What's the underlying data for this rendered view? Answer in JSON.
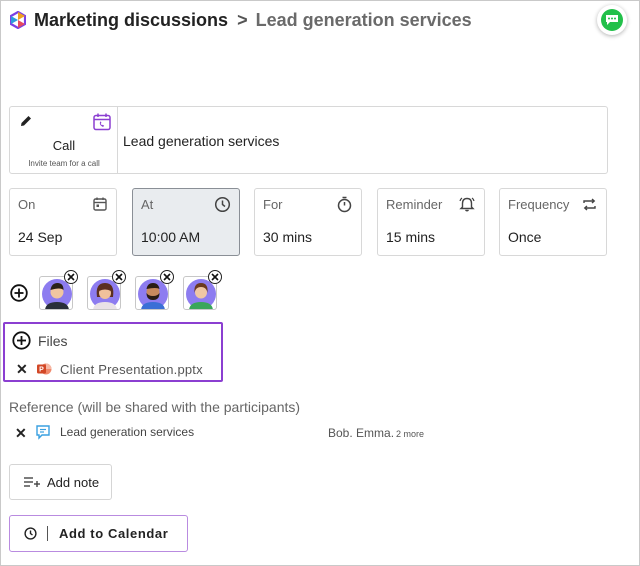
{
  "header": {
    "title": "Marketing discussions",
    "separator": ">",
    "subtitle": "Lead generation services"
  },
  "call": {
    "type_label": "Call",
    "type_hint": "Invite team for a call",
    "subject": "Lead generation services"
  },
  "fields": [
    {
      "label": "On",
      "value": "24 Sep",
      "icon": "calendar-icon"
    },
    {
      "label": "At",
      "value": "10:00 AM",
      "icon": "clock-icon"
    },
    {
      "label": "For",
      "value": "30 mins",
      "icon": "timer-icon"
    },
    {
      "label": "Reminder",
      "value": "15 mins",
      "icon": "bell-icon"
    },
    {
      "label": "Frequency",
      "value": "Once",
      "icon": "repeat-icon"
    }
  ],
  "participants": [
    {
      "avatar": "man-avatar"
    },
    {
      "avatar": "woman-avatar"
    },
    {
      "avatar": "bearded-man-avatar"
    },
    {
      "avatar": "woman-green-avatar"
    }
  ],
  "files": {
    "label": "Files",
    "remove_glyph": "✕",
    "items": [
      {
        "name": "Client Presentation.pptx",
        "icon": "powerpoint-icon"
      }
    ]
  },
  "reference": {
    "heading": "Reference (will be shared with the participants)",
    "remove_glyph": "✕",
    "name": "Lead generation services",
    "people": "Bob. Emma.",
    "more": "2 more"
  },
  "buttons": {
    "add_note": "Add note",
    "add_to_calendar": "Add to Calendar"
  },
  "colors": {
    "accent_purple": "#8b3fd1",
    "chat_green": "#22c04a",
    "active_field_bg": "#e9ecef"
  }
}
